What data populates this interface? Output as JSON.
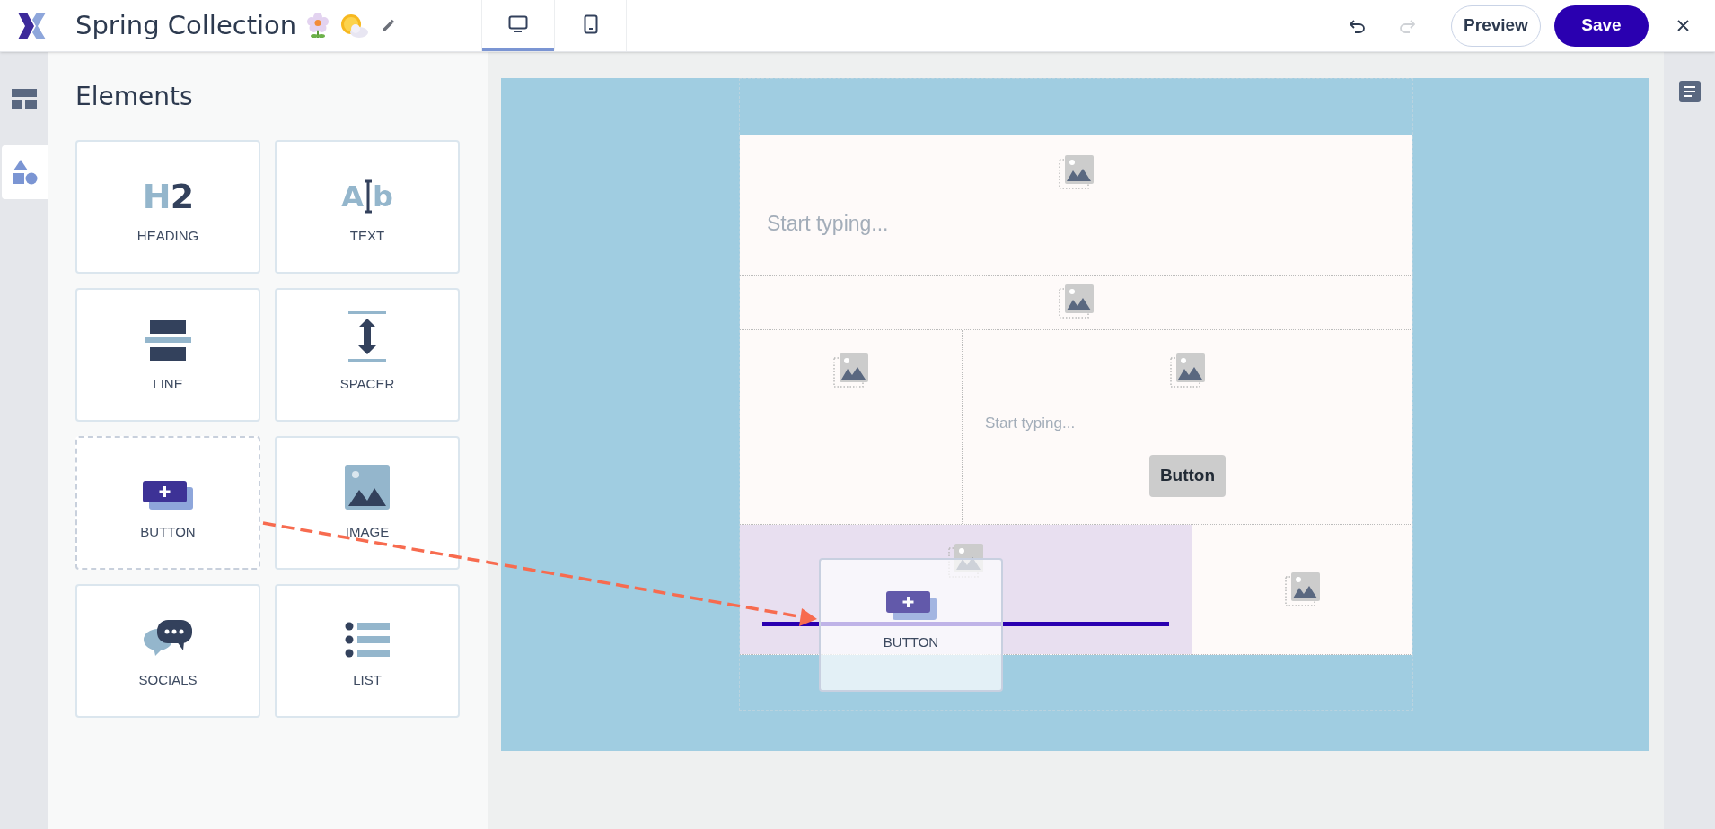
{
  "header": {
    "title": "Spring Collection",
    "device_tabs": [
      {
        "kind": "desktop",
        "selected": true
      },
      {
        "kind": "tablet",
        "selected": false
      }
    ],
    "undo": {
      "disabled": false
    },
    "redo": {
      "disabled": true
    },
    "buttons": [
      {
        "kind": "secondary",
        "label": "Preview"
      },
      {
        "kind": "primary",
        "label": "Save"
      }
    ]
  },
  "rail": {
    "items": [
      {
        "kind": "layout",
        "selected": false
      },
      {
        "kind": "elements",
        "selected": true
      }
    ]
  },
  "panel": {
    "title": "Elements",
    "elements": [
      {
        "kind": "heading",
        "label": "HEADING",
        "glyph": [
          "H",
          "2"
        ],
        "dragging": false
      },
      {
        "kind": "text",
        "label": "TEXT",
        "glyph": [
          "A",
          "b"
        ],
        "dragging": false
      },
      {
        "kind": "line",
        "label": "LINE",
        "dragging": false
      },
      {
        "kind": "spacer",
        "label": "SPACER",
        "dragging": false
      },
      {
        "kind": "button",
        "label": "BUTTON",
        "dragging": true
      },
      {
        "kind": "image",
        "label": "IMAGE",
        "dragging": false
      },
      {
        "kind": "socials",
        "label": "SOCIALS",
        "dragging": false
      },
      {
        "kind": "list",
        "label": "LIST",
        "dragging": false
      }
    ]
  },
  "canvas": {
    "rows": [
      {
        "kind": "tall",
        "columns": [
          {
            "highlighted": false,
            "blocks": [
              {
                "kind": "image"
              },
              {
                "kind": "title",
                "text": "Start typing..."
              }
            ]
          }
        ]
      },
      {
        "kind": "short",
        "columns": [
          {
            "highlighted": false,
            "blocks": [
              {
                "kind": "image"
              }
            ]
          }
        ]
      },
      {
        "kind": "tall",
        "columns": [
          {
            "highlighted": false,
            "blocks": [
              {
                "kind": "image"
              }
            ]
          },
          {
            "highlighted": false,
            "blocks": [
              {
                "kind": "image"
              },
              {
                "kind": "text",
                "text": "Start typing..."
              },
              {
                "kind": "button",
                "text": "Button"
              }
            ]
          }
        ]
      },
      {
        "kind": "bottom",
        "columns": [
          {
            "highlighted": true,
            "blocks": [
              {
                "kind": "image"
              },
              {
                "kind": "divider"
              }
            ]
          },
          {
            "highlighted": false,
            "blocks": [
              {
                "kind": "image"
              }
            ]
          }
        ]
      }
    ]
  },
  "drag_preview": {
    "kind": "button",
    "label": "BUTTON"
  }
}
